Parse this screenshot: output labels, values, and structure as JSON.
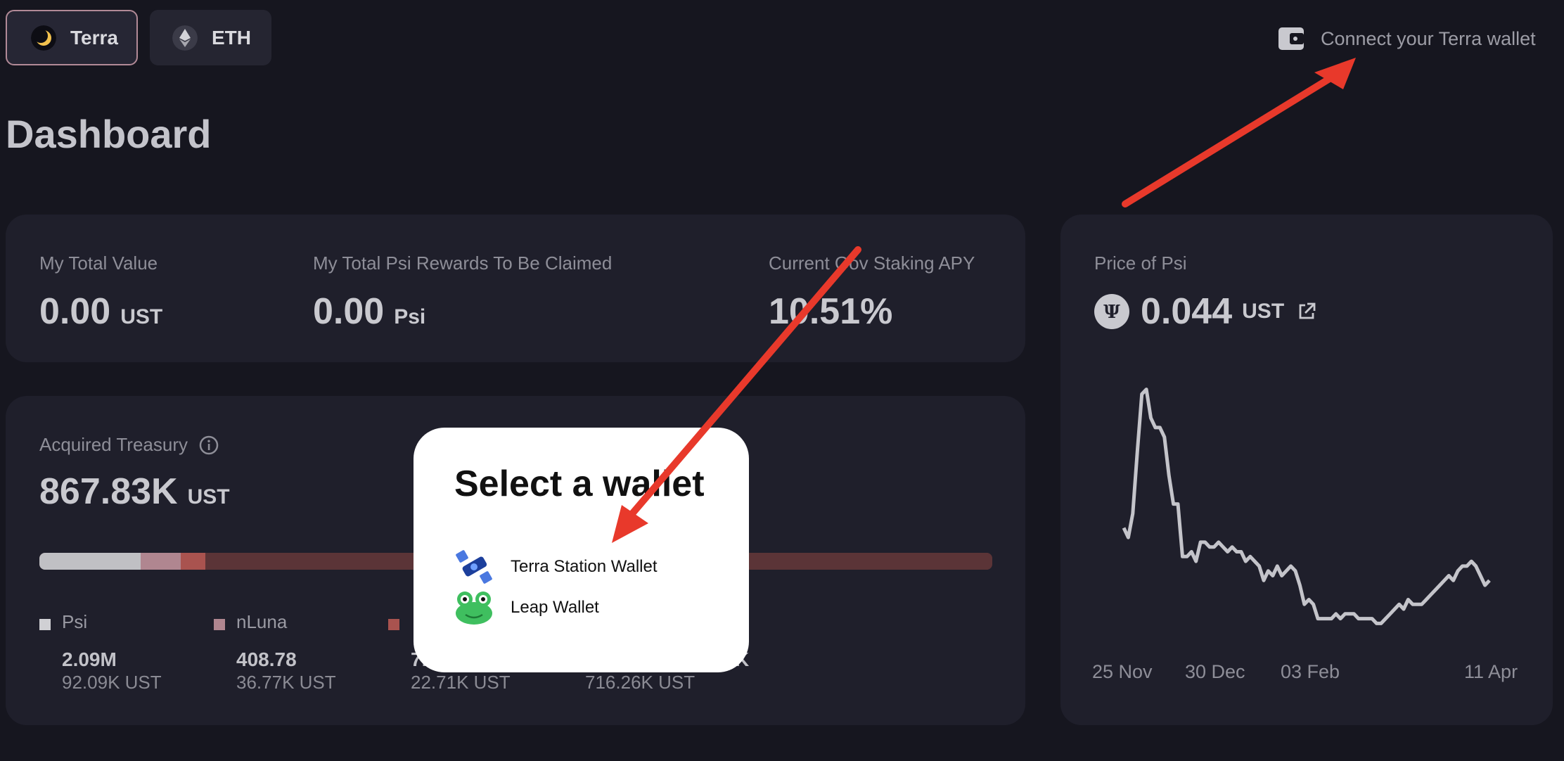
{
  "chains": [
    {
      "label": "Terra",
      "icon": "terra-luna-icon"
    },
    {
      "label": "ETH",
      "icon": "ethereum-icon"
    }
  ],
  "header": {
    "connect_label": "Connect your Terra wallet",
    "connect_icon": "wallet-icon"
  },
  "page_title": "Dashboard",
  "stats": {
    "total_value": {
      "label": "My Total Value",
      "value": "0.00",
      "unit": "UST"
    },
    "rewards": {
      "label": "My Total Psi Rewards To Be Claimed",
      "value": "0.00",
      "unit": "Psi"
    },
    "apy": {
      "label": "Current Gov Staking APY",
      "value": "10.51%"
    }
  },
  "treasury": {
    "label": "Acquired Treasury",
    "info_icon": "info-icon",
    "value": "867.83K",
    "unit": "UST",
    "bar_fractions": [
      0.106,
      0.042,
      0.026,
      0.826
    ],
    "bar_colors": [
      "#c0c0c4",
      "#b08690",
      "#a9534f",
      "#5b3437"
    ],
    "legend": [
      {
        "name": "Psi",
        "color": "#d0d0d4",
        "amount": "2.09M",
        "ust": "92.09K UST"
      },
      {
        "name": "nLuna",
        "color": "#b08690",
        "amount": "408.78",
        "ust": "36.77K UST"
      },
      {
        "name": "",
        "color": "#a9534f",
        "amount": "7.",
        "ust": "22.71K UST"
      },
      {
        "name": "",
        "color": "#5b3437",
        "amount": "K",
        "ust": "716.26K UST"
      }
    ]
  },
  "price": {
    "label": "Price of Psi",
    "icon": "psi-token-icon",
    "value": "0.044",
    "unit": "UST",
    "external_icon": "external-link-icon"
  },
  "chart_data": {
    "type": "line",
    "title": "",
    "x_tick_labels": [
      "25 Nov",
      "30 Dec",
      "03 Feb",
      "11 Apr"
    ],
    "series": [
      {
        "values": [
          0.062,
          0.06,
          0.065,
          0.078,
          0.09,
          0.091,
          0.085,
          0.083,
          0.083,
          0.081,
          0.073,
          0.067,
          0.067,
          0.056,
          0.056,
          0.057,
          0.055,
          0.059,
          0.059,
          0.058,
          0.058,
          0.059,
          0.058,
          0.057,
          0.058,
          0.057,
          0.057,
          0.055,
          0.056,
          0.055,
          0.054,
          0.051,
          0.053,
          0.052,
          0.054,
          0.052,
          0.053,
          0.054,
          0.053,
          0.05,
          0.046,
          0.047,
          0.046,
          0.043,
          0.043,
          0.043,
          0.043,
          0.044,
          0.043,
          0.044,
          0.044,
          0.044,
          0.043,
          0.043,
          0.043,
          0.043,
          0.042,
          0.042,
          0.043,
          0.044,
          0.045,
          0.046,
          0.045,
          0.047,
          0.046,
          0.046,
          0.046,
          0.047,
          0.048,
          0.049,
          0.05,
          0.051,
          0.052,
          0.051,
          0.053,
          0.054,
          0.054,
          0.055,
          0.054,
          0.052,
          0.05,
          0.051
        ]
      }
    ],
    "ylim": [
      0.04,
      0.093
    ]
  },
  "modal": {
    "title": "Select a wallet",
    "options": [
      {
        "label": "Terra Station Wallet",
        "icon": "satellite-icon"
      },
      {
        "label": "Leap Wallet",
        "icon": "frog-icon"
      }
    ]
  },
  "annotation_color": "#e8392b"
}
